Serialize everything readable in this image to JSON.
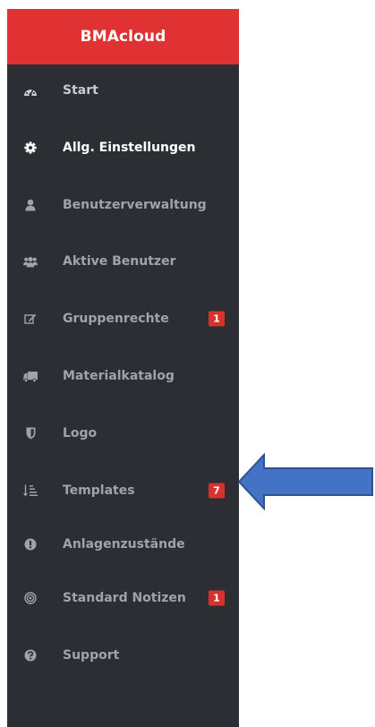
{
  "brand": {
    "title": "BMAcloud",
    "color": "#e03232"
  },
  "sidebar": {
    "background": "#2b2e33",
    "items": [
      {
        "label": "Start",
        "icon": "dashboard-icon",
        "badge": null
      },
      {
        "label": "Allg. Einstellungen",
        "icon": "gear-icon",
        "badge": null,
        "active": true
      },
      {
        "label": "Benutzerverwaltung",
        "icon": "user-icon",
        "badge": null
      },
      {
        "label": "Aktive Benutzer",
        "icon": "users-icon",
        "badge": null
      },
      {
        "label": "Gruppenrechte",
        "icon": "edit-icon",
        "badge": "1"
      },
      {
        "label": "Materialkatalog",
        "icon": "truck-icon",
        "badge": null
      },
      {
        "label": "Logo",
        "icon": "shield-icon",
        "badge": null
      },
      {
        "label": "Templates",
        "icon": "sort-list-icon",
        "badge": "7"
      },
      {
        "label": "Anlagenzustände",
        "icon": "exclamation-circle-icon",
        "badge": null
      },
      {
        "label": "Standard Notizen",
        "icon": "bullseye-icon",
        "badge": "1"
      },
      {
        "label": "Support",
        "icon": "question-circle-icon",
        "badge": null
      }
    ]
  },
  "annotation": {
    "type": "arrow",
    "points_to": "Templates",
    "color": "#4472c4"
  }
}
